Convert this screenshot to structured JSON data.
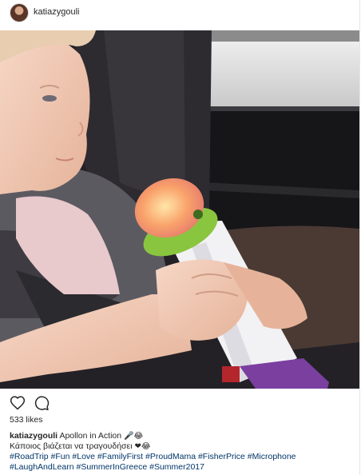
{
  "post": {
    "username": "katiazygouli",
    "likes_text": "533 likes",
    "caption": {
      "username": "katiazygouli",
      "line1_text": "Apollon in Action",
      "line1_emoji": "🎤😂",
      "line2_text": "Κάποιος βιάζεται να τραγουδήσει",
      "line2_emoji": "❤😂",
      "hashtags_line1": "#RoadTrip #Fun #Love #FamilyFirst #ProudMama #FisherPrice #Microphone",
      "hashtags_line2": "#LaughAndLearn #SummerInGreece #Summer2017"
    },
    "icons": {
      "like": "heart-icon",
      "comment": "comment-icon"
    }
  },
  "colors": {
    "link": "#003569",
    "text": "#262626",
    "mic_green": "#8ac53f",
    "mic_purple": "#7b3fa0",
    "glow": "#f9a26b"
  }
}
